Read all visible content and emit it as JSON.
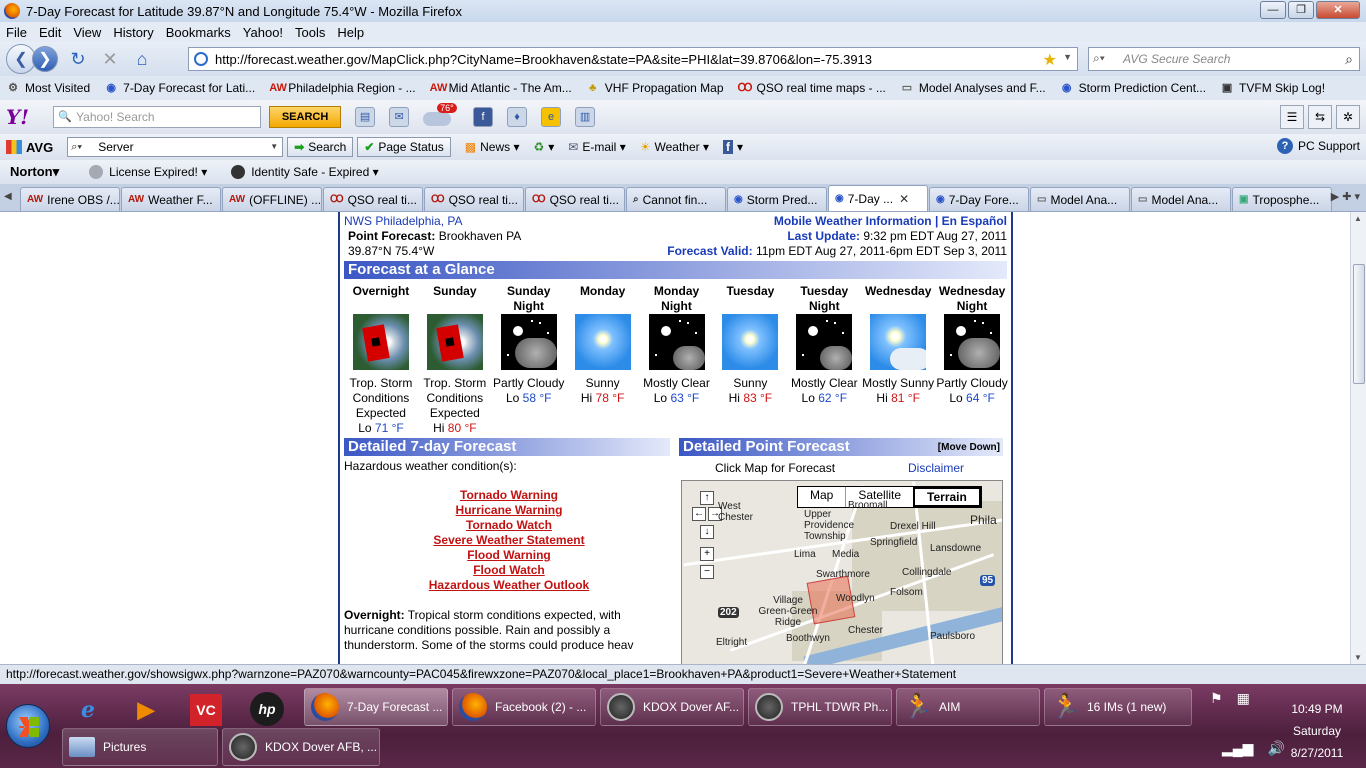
{
  "window": {
    "title": "7-Day Forecast for Latitude 39.87°N and Longitude 75.4°W - Mozilla Firefox",
    "buttons": {
      "minimize": "—",
      "maximize": "❐",
      "close": "✕"
    }
  },
  "menubar": {
    "items": [
      "File",
      "Edit",
      "View",
      "History",
      "Bookmarks",
      "Yahoo!",
      "Tools",
      "Help"
    ]
  },
  "navbar": {
    "url": "http://forecast.weather.gov/MapClick.php?CityName=Brookhaven&state=PA&site=PHI&lat=39.8706&lon=-75.3913",
    "search_placeholder": "AVG Secure Search"
  },
  "bookmarks": [
    {
      "label": "Most Visited",
      "icon": "⚙"
    },
    {
      "label": "7-Day Forecast for Lati...",
      "icon": "◉"
    },
    {
      "label": "Philadelphia Region - ...",
      "icon": "AW"
    },
    {
      "label": "Mid Atlantic - The Am...",
      "icon": "AW"
    },
    {
      "label": "VHF Propagation Map",
      "icon": "♣"
    },
    {
      "label": "QSO real time maps - ...",
      "icon": "Ꝏ"
    },
    {
      "label": "Model Analyses and F...",
      "icon": "▭"
    },
    {
      "label": "Storm Prediction Cent...",
      "icon": "◉"
    },
    {
      "label": "TVFM Skip Log!",
      "icon": "▣"
    }
  ],
  "yahoo_toolbar": {
    "logo": "Y!",
    "search_placeholder": "Yahoo! Search",
    "search_button": "SEARCH",
    "weather_temp": "76°"
  },
  "avg_toolbar": {
    "logo": "AVG",
    "search_value": "Server",
    "search_button": "Search",
    "page_status": "Page Status",
    "news": "News",
    "email": "E-mail",
    "weather": "Weather",
    "pc_support": "PC Support"
  },
  "norton_toolbar": {
    "logo": "Norton",
    "license": "License Expired!",
    "identity": "Identity Safe - Expired"
  },
  "tabs": [
    {
      "label": "Irene OBS /...",
      "icon": "AW"
    },
    {
      "label": "Weather F...",
      "icon": "AW"
    },
    {
      "label": "(OFFLINE) ...",
      "icon": "AW"
    },
    {
      "label": "QSO real ti...",
      "icon": "Ꝏ"
    },
    {
      "label": "QSO real ti...",
      "icon": "Ꝏ"
    },
    {
      "label": "QSO real ti...",
      "icon": "Ꝏ"
    },
    {
      "label": "Cannot fin...",
      "icon": "⌕"
    },
    {
      "label": "Storm Pred...",
      "icon": "◉"
    },
    {
      "label": "7-Day ...",
      "icon": "◉",
      "active": true
    },
    {
      "label": "7-Day Fore...",
      "icon": "◉"
    },
    {
      "label": "Model Ana...",
      "icon": "▭"
    },
    {
      "label": "Model Ana...",
      "icon": "▭"
    },
    {
      "label": "Troposphe...",
      "icon": "▣"
    }
  ],
  "page": {
    "office": "NWS Philadelphia, PA",
    "point_forecast_label": "Point Forecast:",
    "point_forecast_value": "Brookhaven PA",
    "coords": "39.87°N 75.4°W",
    "mobile": "Mobile Weather Information | En Español",
    "last_update_label": "Last Update:",
    "last_update_value": "9:32 pm EDT Aug 27, 2011",
    "valid_label": "Forecast Valid:",
    "valid_value": "11pm EDT Aug 27, 2011-6pm EDT Sep 3, 2011",
    "glance_heading": "Forecast at a Glance",
    "periods": [
      {
        "name": "Overnight",
        "img": "storm",
        "desc": "Trop. Storm Conditions Expected",
        "kind": "Lo",
        "temp": "71 °F"
      },
      {
        "name": "Sunday",
        "img": "storm",
        "desc": "Trop. Storm Conditions Expected",
        "kind": "Hi",
        "temp": "80 °F"
      },
      {
        "name": "Sunday Night",
        "img": "night-cloudy",
        "desc": "Partly Cloudy",
        "kind": "Lo",
        "temp": "58 °F"
      },
      {
        "name": "Monday",
        "img": "sunny",
        "desc": "Sunny",
        "kind": "Hi",
        "temp": "78 °F"
      },
      {
        "name": "Monday Night",
        "img": "night-clear",
        "desc": "Mostly Clear",
        "kind": "Lo",
        "temp": "63 °F"
      },
      {
        "name": "Tuesday",
        "img": "sunny",
        "desc": "Sunny",
        "kind": "Hi",
        "temp": "83 °F"
      },
      {
        "name": "Tuesday Night",
        "img": "night-clear",
        "desc": "Mostly Clear",
        "kind": "Lo",
        "temp": "62 °F"
      },
      {
        "name": "Wednesday",
        "img": "msunny",
        "desc": "Mostly Sunny",
        "kind": "Hi",
        "temp": "81 °F"
      },
      {
        "name": "Wednesday Night",
        "img": "night-cloudy",
        "desc": "Partly Cloudy",
        "kind": "Lo",
        "temp": "64 °F"
      }
    ],
    "detailed_heading": "Detailed 7-day Forecast",
    "hazard_intro": "Hazardous weather condition(s):",
    "hazards": [
      "Tornado Warning",
      "Hurricane Warning",
      "Tornado Watch",
      "Severe Weather Statement",
      "Flood Warning",
      "Flood Watch",
      "Hazardous Weather Outlook"
    ],
    "overnight_label": "Overnight:",
    "overnight_text": "Tropical storm conditions expected, with hurricane conditions possible. Rain and possibly a thunderstorm. Some of the storms could produce heav",
    "point_heading": "Detailed Point Forecast",
    "move_down": "[Move Down]",
    "click_map": "Click Map for Forecast",
    "disclaimer": "Disclaimer",
    "map_types": [
      "Map",
      "Satellite",
      "Terrain"
    ],
    "map_labels": [
      "West",
      "Chester",
      "Upper Providence Township",
      "Broomall",
      "Drexel Hill",
      "Phila",
      "Springfield",
      "Lansdowne",
      "Lima",
      "Media",
      "Swarthmore",
      "Collingdale",
      "Folsom",
      "Woodlyn",
      "Village Green-Green Ridge",
      "Chester",
      "Boothwyn",
      "Paulsboro",
      "Eltright"
    ],
    "map_shields": [
      "202",
      "95"
    ]
  },
  "statusbar": "http://forecast.weather.gov/showsigwx.php?warnzone=PAZ070&warncounty=PAC045&firewxzone=PAZ070&local_place1=Brookhaven+PA&product1=Severe+Weather+Statement",
  "taskbar": {
    "buttons_row1": [
      {
        "label": "7-Day Forecast ...",
        "icon": "fx",
        "active": true
      },
      {
        "label": "Facebook (2) - ...",
        "icon": "fx"
      },
      {
        "label": "KDOX Dover AF...",
        "icon": "radar"
      },
      {
        "label": "TPHL TDWR Ph...",
        "icon": "radar"
      },
      {
        "label": "AIM",
        "icon": "aim"
      },
      {
        "label": "16 IMs (1 new)",
        "icon": "aim"
      }
    ],
    "buttons_row2": [
      {
        "label": "Pictures",
        "icon": "pic"
      },
      {
        "label": "KDOX Dover AFB, ...",
        "icon": "radar"
      }
    ],
    "pins": [
      "e",
      "▶",
      "VC",
      "hp"
    ],
    "clock_time": "10:49 PM",
    "clock_day": "Saturday",
    "clock_date": "8/27/2011"
  }
}
